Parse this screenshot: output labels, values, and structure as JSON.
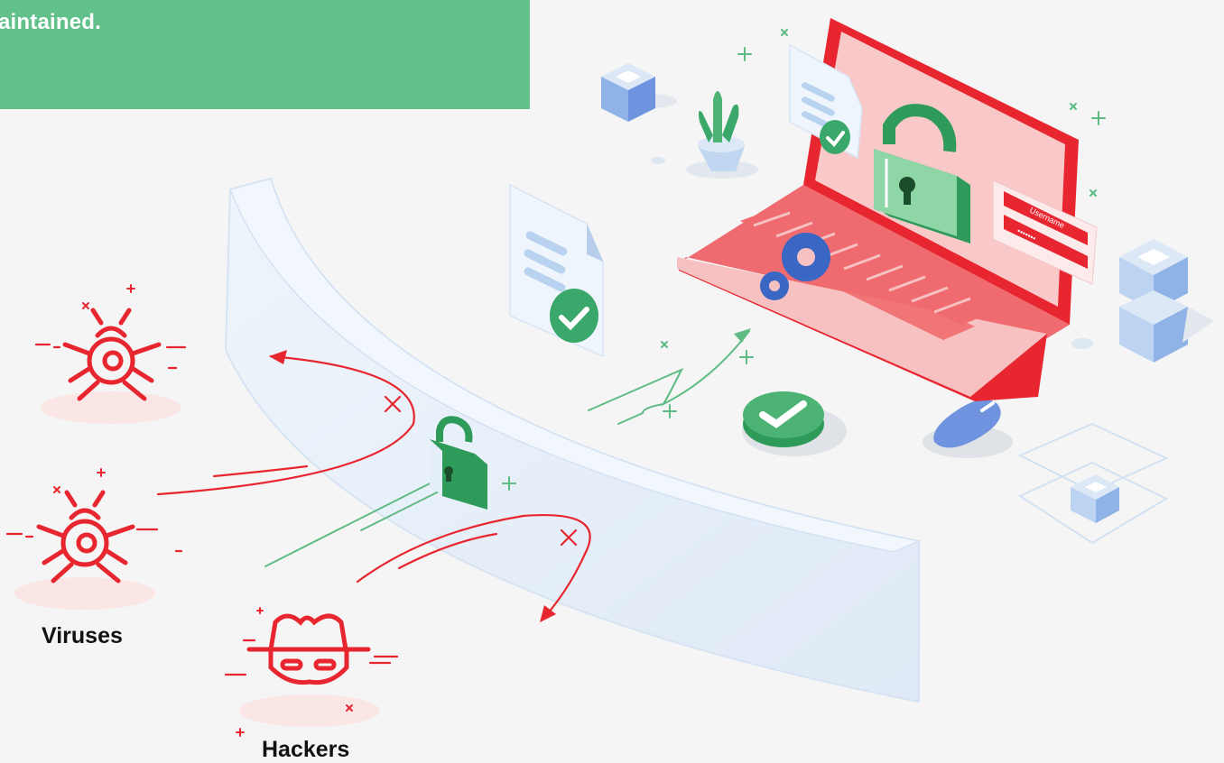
{
  "banner": {
    "text": "aintained."
  },
  "threats": {
    "viruses_label": "Viruses",
    "hackers_label": "Hackers"
  },
  "login_card": {
    "username_label": "Username",
    "password_mask": "•••••••"
  },
  "colors": {
    "threat_red": "#e8262f",
    "safe_green": "#2f9b5a",
    "banner_green": "#62c08a",
    "shield_blue": "#e4eef9",
    "laptop_pink": "#f6c5c6",
    "laptop_red": "#e8262f",
    "cube_blue": "#8fb3e6",
    "mouse_blue": "#6f93df"
  },
  "icons": [
    "bug-icon",
    "hacker-icon",
    "lock-icon",
    "check-icon",
    "gear-icon",
    "document-icon",
    "cube-icon",
    "plant-icon",
    "mouse-icon",
    "laptop-icon"
  ]
}
